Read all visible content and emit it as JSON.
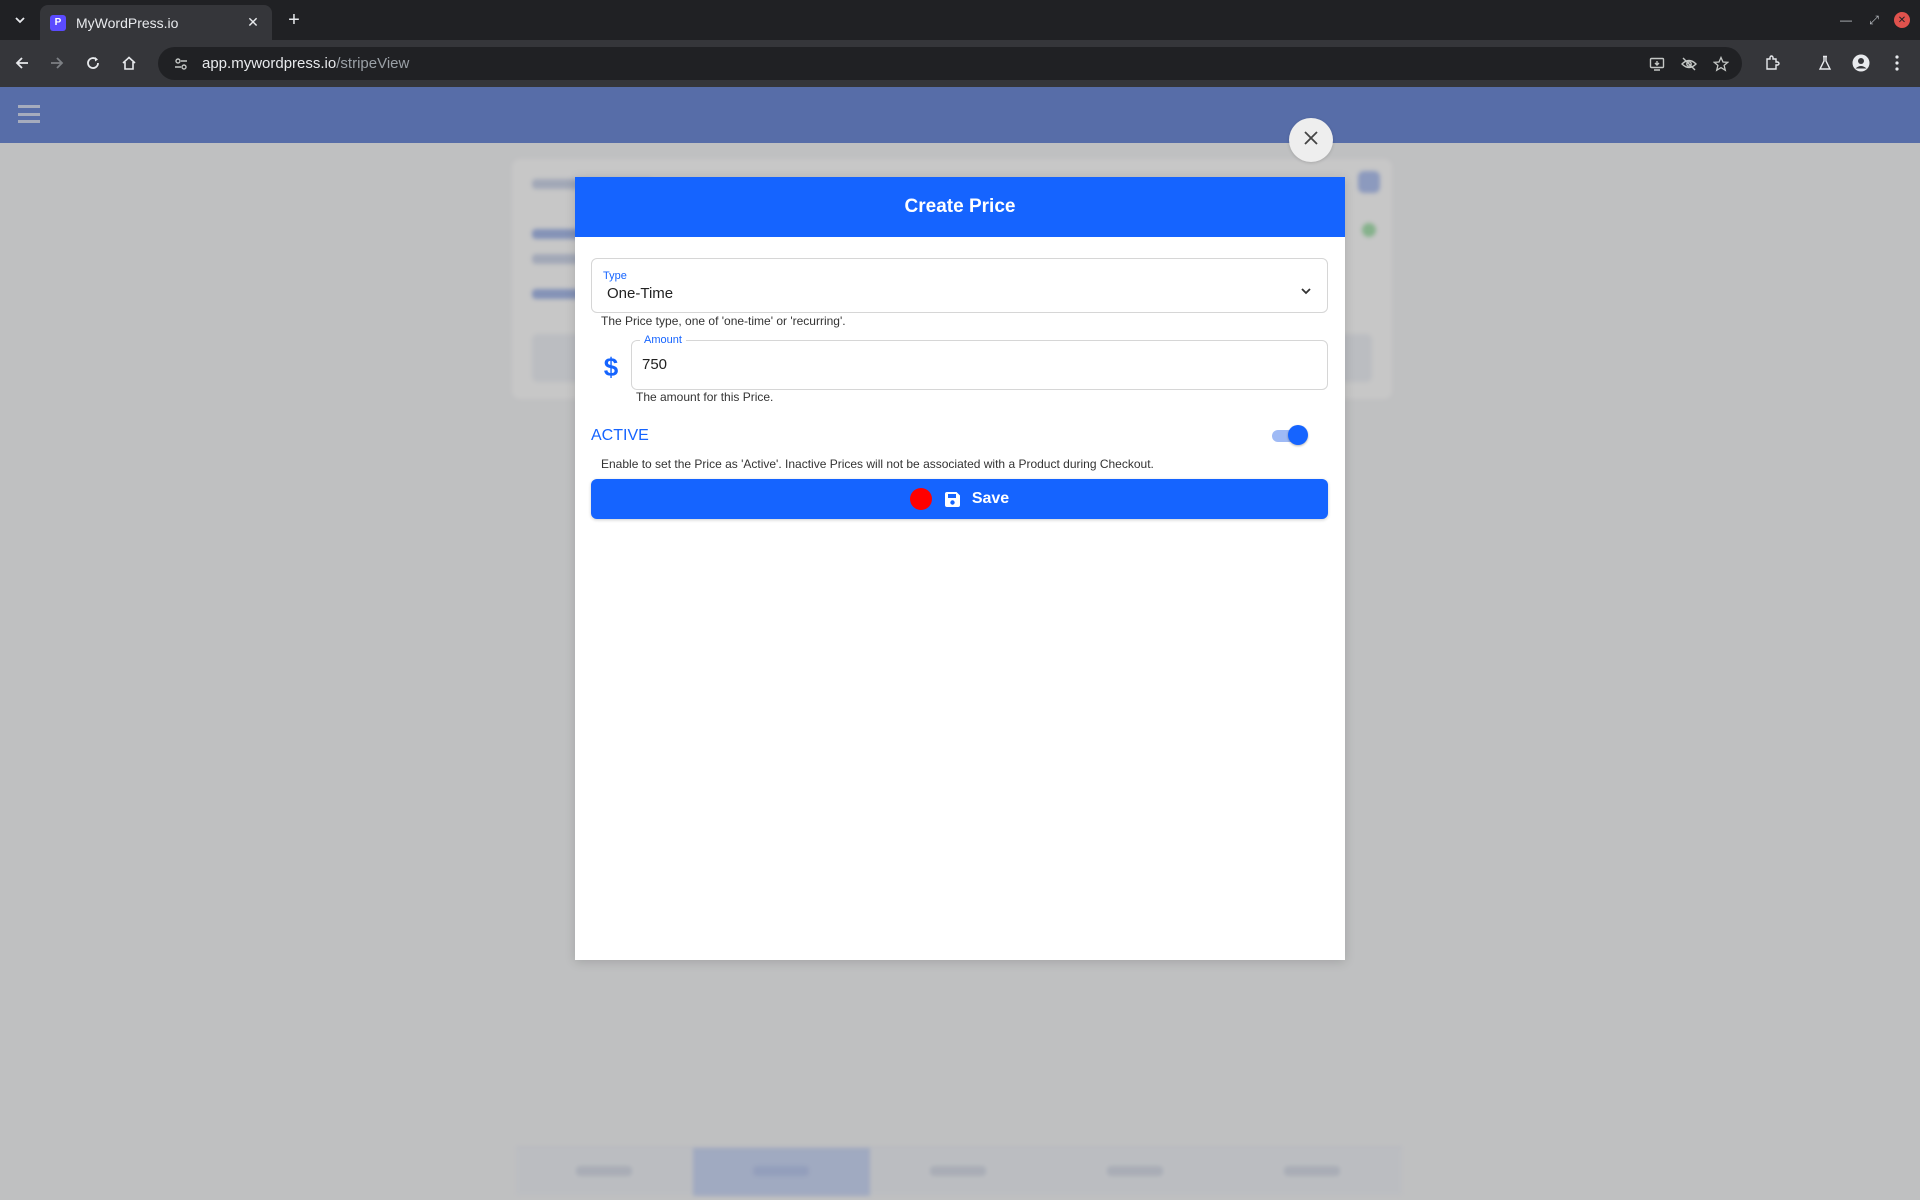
{
  "browser": {
    "tab_title": "MyWordPress.io",
    "tab_favicon_letter": "P",
    "url_host": "app.mywordpress.io",
    "url_path": "/stripeView"
  },
  "modal": {
    "title": "Create Price",
    "type_field": {
      "label": "Type",
      "value": "One-Time",
      "helper": "The Price type, one of 'one-time' or 'recurring'."
    },
    "amount_field": {
      "label": "Amount",
      "value": "750",
      "helper": "The amount for this Price."
    },
    "active": {
      "label": "ACTIVE",
      "enabled": true,
      "helper": "Enable to set the Price as 'Active'.  Inactive Prices will not be associated with a Product during Checkout."
    },
    "save_label": "Save"
  },
  "colors": {
    "primary": "#1564ff",
    "record_indicator": "#ff0000"
  },
  "icons": [
    "chevron-down-icon",
    "dollar-icon",
    "save-icon",
    "close-icon"
  ]
}
